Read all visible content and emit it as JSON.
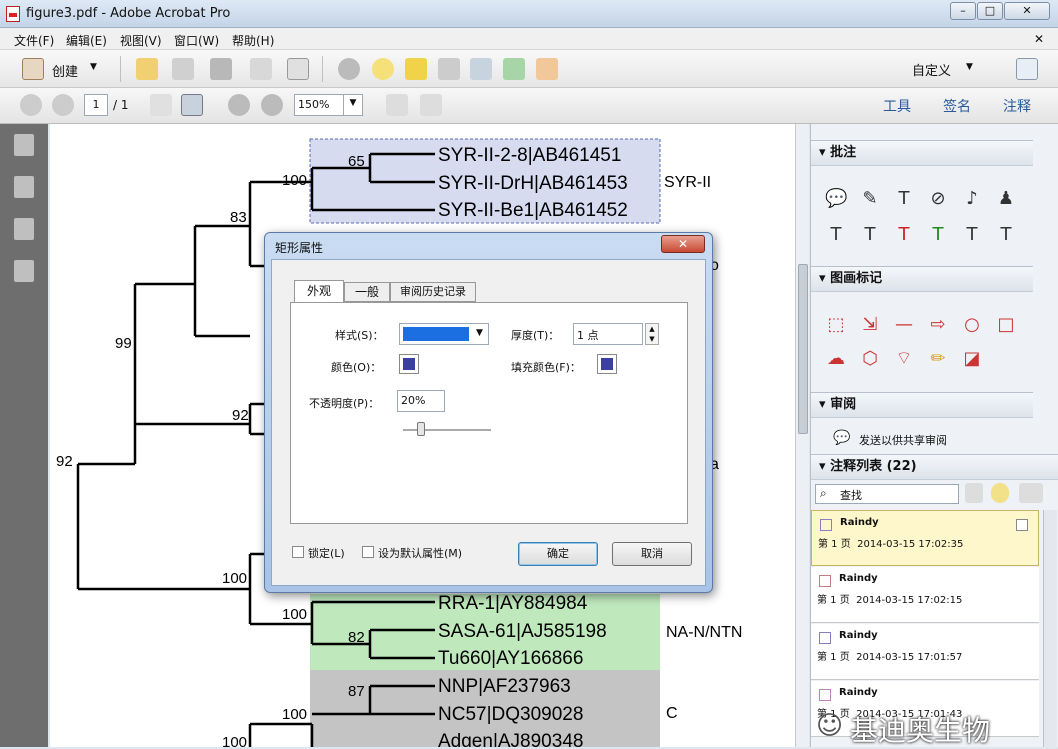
{
  "window": {
    "title": "figure3.pdf - Adobe Acrobat Pro"
  },
  "menu": [
    "文件(F)",
    "编辑(E)",
    "视图(V)",
    "窗口(W)",
    "帮助(H)"
  ],
  "toolbar": {
    "create": "创建",
    "customize": "自定义"
  },
  "nav": {
    "page": "1",
    "total": "/ 1",
    "zoom": "150%",
    "tools": "工具",
    "sign": "签名",
    "comment": "注释"
  },
  "tree": {
    "bootstrap": [
      "65",
      "100",
      "83",
      "99",
      "92",
      "92",
      "100",
      "100",
      "82",
      "87",
      "100",
      "100"
    ],
    "leaves": [
      "SYR-II-2-8|AB461451",
      "SYR-II-DrH|AB461453",
      "SYR-II-Be1|AB461452",
      "RRA-1|AY884984",
      "SASA-61|AJ585198",
      "Tu660|AY166866",
      "NNP|AF237963",
      "NC57|DQ309028",
      "Adgen|AJ890348"
    ],
    "groups": [
      "SYR-II",
      "NA-N/NTN",
      "C"
    ],
    "partial": [
      "o",
      "a"
    ]
  },
  "dialog": {
    "title": "矩形属性",
    "tabs": [
      "外观",
      "一般",
      "审阅历史记录"
    ],
    "style_label": "样式(S)：",
    "thickness_label": "厚度(T)：",
    "thickness_value": "1 点",
    "color_label": "颜色(O)：",
    "fill_label": "填充颜色(F)：",
    "opacity_label": "不透明度(P)：",
    "opacity_value": "20%",
    "lock": "锁定(L)",
    "default": "设为默认属性(M)",
    "ok": "确定",
    "cancel": "取消",
    "color": "#3b3fa0",
    "line_color": "#1c6fe0",
    "opacity": 0.2
  },
  "panel": {
    "annotations": "批注",
    "drawing": "图画标记",
    "review": "审阅",
    "send": "发送以供共享审阅",
    "list": "注释列表 (22)",
    "search": "查找",
    "comments": [
      {
        "author": "Raindy",
        "page": "第 1 页",
        "time": "2014-03-15 17:02:35"
      },
      {
        "author": "Raindy",
        "page": "第 1 页",
        "time": "2014-03-15 17:02:15"
      },
      {
        "author": "Raindy",
        "page": "第 1 页",
        "time": "2014-03-15 17:01:57"
      },
      {
        "author": "Raindy",
        "page": "第 1 页",
        "time": "2014-03-15 17:01:43"
      }
    ]
  },
  "watermark": "基迪奥生物",
  "colors": {
    "highlight": "#d6dbf0",
    "green": "#bfe8bd",
    "gray": "#c4c4c4",
    "selected_card": "#fff7cc"
  }
}
